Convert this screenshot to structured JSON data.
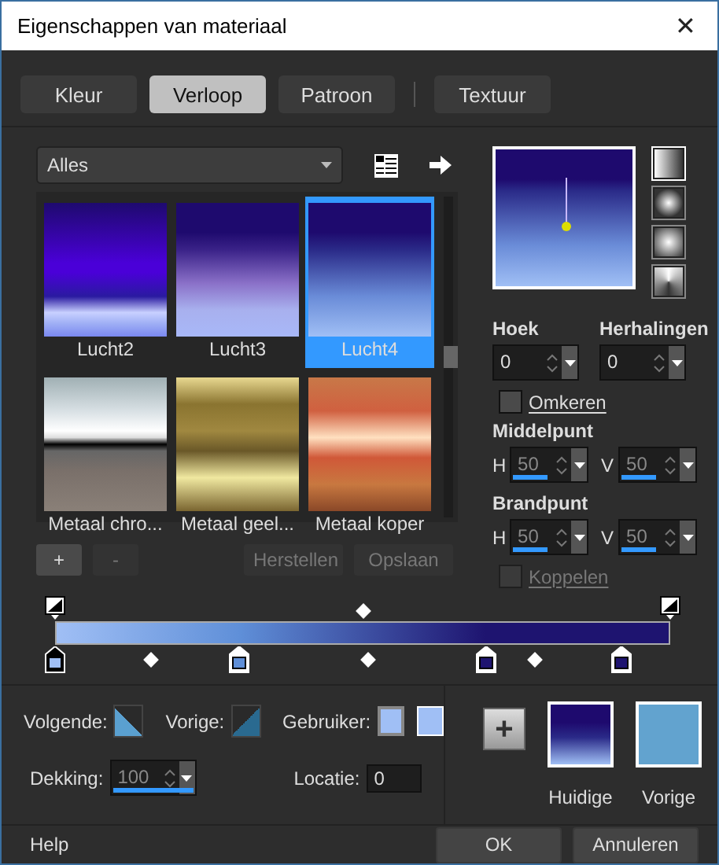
{
  "window": {
    "title": "Eigenschappen van materiaal",
    "close": "✕"
  },
  "tabs": [
    {
      "label": "Kleur",
      "selected": false
    },
    {
      "label": "Verloop",
      "selected": true
    },
    {
      "label": "Patroon",
      "selected": false
    },
    {
      "label": "Textuur",
      "selected": false
    }
  ],
  "category": {
    "value": "Alles"
  },
  "presets": [
    {
      "name": "Lucht2",
      "selected": false
    },
    {
      "name": "Lucht3",
      "selected": false
    },
    {
      "name": "Lucht4",
      "selected": true
    },
    {
      "name": "Metaal chro...",
      "selected": false
    },
    {
      "name": "Metaal geel...",
      "selected": false
    },
    {
      "name": "Metaal koper",
      "selected": false
    }
  ],
  "preset_buttons": [
    {
      "label": "+",
      "disabled": false
    },
    {
      "label": "-",
      "disabled": true
    },
    {
      "label": "Herstellen",
      "disabled": true
    },
    {
      "label": "Opslaan",
      "disabled": true
    }
  ],
  "styles": [
    {
      "kind": "linear",
      "selected": true
    },
    {
      "kind": "rectangular",
      "selected": false
    },
    {
      "kind": "sunburst",
      "selected": false
    },
    {
      "kind": "radial",
      "selected": false
    }
  ],
  "angle": {
    "label": "Hoek",
    "value": "0"
  },
  "repeats": {
    "label": "Herhalingen",
    "value": "0"
  },
  "invert": {
    "label": "Omkeren",
    "checked": false,
    "disabled": false
  },
  "center": {
    "label": "Middelpunt",
    "h": {
      "label": "H",
      "value": "50",
      "level": 0.5
    },
    "v": {
      "label": "V",
      "value": "50",
      "level": 0.5
    }
  },
  "focus": {
    "label": "Brandpunt",
    "h": {
      "label": "H",
      "value": "50",
      "level": 0.5
    },
    "v": {
      "label": "V",
      "value": "50",
      "level": 0.5
    }
  },
  "link": {
    "label": "Koppelen",
    "checked": false,
    "disabled": true
  },
  "editor": {
    "color_stops": [
      {
        "color": "#a0bff5",
        "selected": true
      },
      {
        "color": "#5f8fd8",
        "selected": false
      },
      {
        "color": "#1e1470",
        "selected": false
      },
      {
        "color": "#1e1470",
        "selected": false
      }
    ]
  },
  "next": {
    "label": "Volgende:"
  },
  "previous": {
    "label": "Vorige:"
  },
  "user": {
    "label": "Gebruiker:"
  },
  "opacity": {
    "label": "Dekking:",
    "value": "100",
    "level": 1
  },
  "location": {
    "label": "Locatie:",
    "value": "0"
  },
  "current": {
    "label": "Huidige"
  },
  "previous_swatch": {
    "label": "Vorige"
  },
  "add_swatch": "+",
  "footer": {
    "help": "Help",
    "ok": "OK",
    "cancel": "Annuleren"
  }
}
